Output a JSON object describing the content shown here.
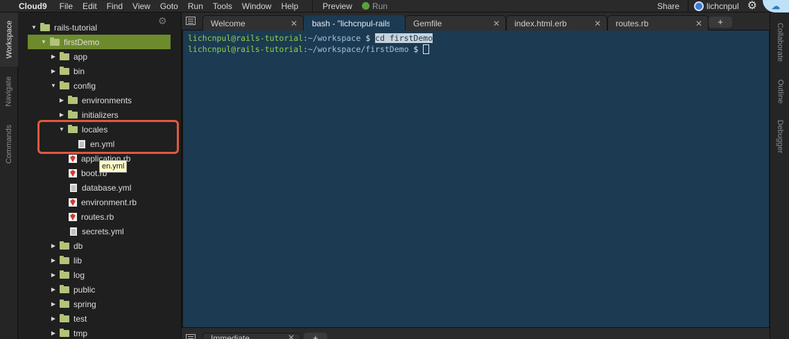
{
  "menubar": {
    "brand": "Cloud9",
    "items": [
      "File",
      "Edit",
      "Find",
      "View",
      "Goto",
      "Run",
      "Tools",
      "Window",
      "Help"
    ],
    "preview": "Preview",
    "run": "Run",
    "share": "Share",
    "user": "lichcnpul"
  },
  "left_rail": {
    "workspace": "Workspace",
    "navigate": "Navigate",
    "commands": "Commands"
  },
  "right_rail": {
    "collaborate": "Collaborate",
    "outline": "Outline",
    "debugger": "Debugger"
  },
  "tree": {
    "rows": [
      {
        "label": "rails-tutorial",
        "type": "folder",
        "open": true,
        "depth": 0
      },
      {
        "label": "firstDemo",
        "type": "folder",
        "open": true,
        "depth": 1,
        "selected": true
      },
      {
        "label": "app",
        "type": "folder",
        "open": false,
        "depth": 2
      },
      {
        "label": "bin",
        "type": "folder",
        "open": false,
        "depth": 2
      },
      {
        "label": "config",
        "type": "folder",
        "open": true,
        "depth": 2
      },
      {
        "label": "environments",
        "type": "folder",
        "open": false,
        "depth": 3
      },
      {
        "label": "initializers",
        "type": "folder",
        "open": false,
        "depth": 3
      },
      {
        "label": "locales",
        "type": "folder",
        "open": true,
        "depth": 3
      },
      {
        "label": "en.yml",
        "type": "file",
        "depth": 4
      },
      {
        "label": "application.rb",
        "type": "ruby",
        "depth": 3
      },
      {
        "label": "boot.rb",
        "type": "ruby",
        "depth": 3
      },
      {
        "label": "database.yml",
        "type": "file",
        "depth": 3
      },
      {
        "label": "environment.rb",
        "type": "ruby",
        "depth": 3
      },
      {
        "label": "routes.rb",
        "type": "ruby",
        "depth": 3
      },
      {
        "label": "secrets.yml",
        "type": "file",
        "depth": 3
      },
      {
        "label": "db",
        "type": "folder",
        "open": false,
        "depth": 2
      },
      {
        "label": "lib",
        "type": "folder",
        "open": false,
        "depth": 2
      },
      {
        "label": "log",
        "type": "folder",
        "open": false,
        "depth": 2
      },
      {
        "label": "public",
        "type": "folder",
        "open": false,
        "depth": 2
      },
      {
        "label": "spring",
        "type": "folder",
        "open": false,
        "depth": 2
      },
      {
        "label": "test",
        "type": "folder",
        "open": false,
        "depth": 2
      },
      {
        "label": "tmp",
        "type": "folder",
        "open": false,
        "depth": 2
      }
    ],
    "tooltip": "en.yml"
  },
  "tabs": [
    {
      "label": "Welcome",
      "active": false
    },
    {
      "label": "bash - \"lichcnpul-rails-",
      "active": true
    },
    {
      "label": "Gemfile",
      "active": false
    },
    {
      "label": "index.html.erb",
      "active": false
    },
    {
      "label": "routes.rb",
      "active": false
    }
  ],
  "tab_add": "+",
  "terminal": {
    "line1": {
      "user": "lichcnpul@rails-tutorial",
      "path": ":~/workspace",
      "prompt": " $ ",
      "cmd": "cd firstDemo"
    },
    "line2": {
      "user": "lichcnpul@rails-tutorial",
      "path": ":~/workspace/firstDemo",
      "prompt": " $ "
    }
  },
  "console": {
    "tab": "Immediate",
    "add": "+"
  },
  "colors": {
    "accent_selected": "#6d8b2d",
    "highlight": "#e05a3c",
    "terminal_bg": "#1c3a52"
  }
}
